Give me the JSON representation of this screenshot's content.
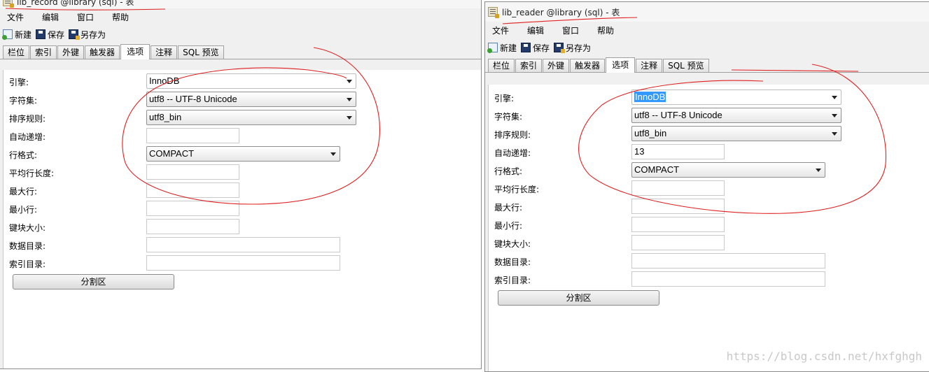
{
  "left_window": {
    "title": "lib_record @library (sql) - 表",
    "menu": [
      "文件",
      "编辑",
      "窗口",
      "帮助"
    ],
    "toolbar": {
      "new": "新建",
      "save": "保存",
      "save_as": "另存为"
    },
    "tabs": [
      "栏位",
      "索引",
      "外键",
      "触发器",
      "选项",
      "注释",
      "SQL 预览"
    ],
    "active_tab": "选项",
    "labels": {
      "engine": "引擎:",
      "charset": "字符集:",
      "collation": "排序规则:",
      "auto_increment": "自动递增:",
      "row_format": "行格式:",
      "avg_row_length": "平均行长度:",
      "max_rows": "最大行:",
      "min_rows": "最小行:",
      "key_block_size": "键块大小:",
      "data_directory": "数据目录:",
      "index_directory": "索引目录:"
    },
    "values": {
      "engine": "InnoDB",
      "charset": "utf8 -- UTF-8 Unicode",
      "collation": "utf8_bin",
      "auto_increment": "",
      "row_format": "COMPACT",
      "avg_row_length": "",
      "max_rows": "",
      "min_rows": "",
      "key_block_size": "",
      "data_directory": "",
      "index_directory": ""
    },
    "partition_button": "分割区"
  },
  "right_window": {
    "title": "lib_reader @library (sql) - 表",
    "menu": [
      "文件",
      "编辑",
      "窗口",
      "帮助"
    ],
    "toolbar": {
      "new": "新建",
      "save": "保存",
      "save_as": "另存为"
    },
    "tabs": [
      "栏位",
      "索引",
      "外键",
      "触发器",
      "选项",
      "注释",
      "SQL 预览"
    ],
    "active_tab": "选项",
    "labels": {
      "engine": "引擎:",
      "charset": "字符集:",
      "collation": "排序规则:",
      "auto_increment": "自动递增:",
      "row_format": "行格式:",
      "avg_row_length": "平均行长度:",
      "max_rows": "最大行:",
      "min_rows": "最小行:",
      "key_block_size": "键块大小:",
      "data_directory": "数据目录:",
      "index_directory": "索引目录:"
    },
    "values": {
      "engine": "InnoDB",
      "charset": "utf8 -- UTF-8 Unicode",
      "collation": "utf8_bin",
      "auto_increment": "13",
      "row_format": "COMPACT",
      "avg_row_length": "",
      "max_rows": "",
      "min_rows": "",
      "key_block_size": "",
      "data_directory": "",
      "index_directory": ""
    },
    "partition_button": "分割区"
  },
  "watermark": "https://blog.csdn.net/hxfghgh",
  "colors": {
    "annotation": "#e02020",
    "selection": "#3399ff"
  }
}
